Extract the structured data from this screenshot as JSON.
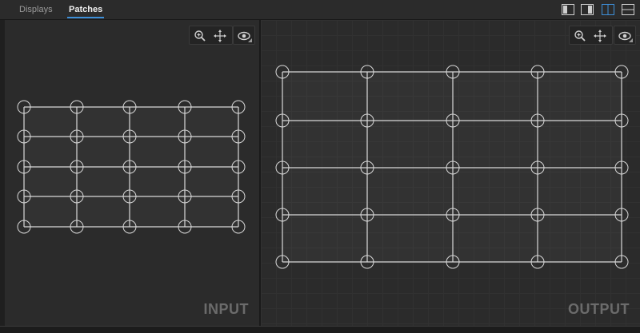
{
  "tabs": [
    {
      "label": "Displays",
      "active": false
    },
    {
      "label": "Patches",
      "active": true
    }
  ],
  "layout_buttons": [
    {
      "icon": "layout-left-panel-icon",
      "active": false
    },
    {
      "icon": "layout-right-panel-icon",
      "active": false
    },
    {
      "icon": "layout-split-vertical-icon",
      "active": true
    },
    {
      "icon": "layout-split-horizontal-icon",
      "active": false
    }
  ],
  "input_panel": {
    "label": "INPUT",
    "tools": [
      "zoom-icon",
      "pan-icon",
      "eye-icon"
    ],
    "mesh": {
      "columns": 5,
      "rows": 5
    }
  },
  "output_panel": {
    "label": "OUTPUT",
    "tools": [
      "zoom-icon",
      "pan-icon",
      "eye-icon"
    ],
    "mesh": {
      "columns": 5,
      "rows": 5
    }
  },
  "colors": {
    "accent": "#3d8fd8",
    "mesh_line": "#d8d8d8",
    "label": "#6b6b6b"
  }
}
